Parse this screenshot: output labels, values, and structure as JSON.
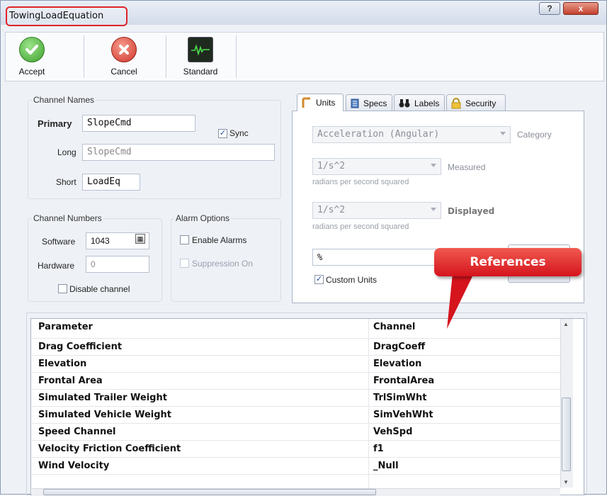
{
  "window": {
    "title": "TowingLoadEquation",
    "help_label": "?",
    "close_label": "x"
  },
  "toolbar": {
    "accept_label": "Accept",
    "cancel_label": "Cancel",
    "standard_label": "Standard"
  },
  "channel_names": {
    "group_label": "Channel Names",
    "primary_label": "Primary",
    "primary_value": "SlopeCmd",
    "sync_label": "Sync",
    "sync_checked": true,
    "long_label": "Long",
    "long_value": "SlopeCmd",
    "short_label": "Short",
    "short_value": "LoadEq"
  },
  "channel_numbers": {
    "group_label": "Channel Numbers",
    "software_label": "Software",
    "software_value": "1043",
    "hardware_label": "Hardware",
    "hardware_value": "0",
    "disable_label": "Disable channel"
  },
  "alarm_options": {
    "group_label": "Alarm Options",
    "enable_label": "Enable Alarms",
    "suppression_label": "Suppression On"
  },
  "tabs": [
    {
      "label": "Units",
      "icon": "units-icon"
    },
    {
      "label": "Specs",
      "icon": "specs-icon"
    },
    {
      "label": "Labels",
      "icon": "binoculars-icon"
    },
    {
      "label": "Security",
      "icon": "lock-icon"
    }
  ],
  "units": {
    "category_value": "Acceleration (Angular)",
    "category_label": "Category",
    "measured_value": "1/s^2",
    "measured_label": "Measured",
    "measured_hint": "radians per second squared",
    "displayed_value": "1/s^2",
    "displayed_label": "Displayed",
    "displayed_hint": "radians per second squared",
    "custom_value": "%",
    "custom_units_label": "Custom Units",
    "custom_units_checked": true
  },
  "callout": {
    "text": "References",
    "color": "#e0242a"
  },
  "table": {
    "headers": [
      "Parameter",
      "Channel"
    ],
    "rows": [
      {
        "parameter": "Drag Coefficient",
        "channel": "DragCoeff"
      },
      {
        "parameter": "Elevation",
        "channel": "Elevation"
      },
      {
        "parameter": "Frontal Area",
        "channel": "FrontalArea"
      },
      {
        "parameter": "Simulated Trailer Weight",
        "channel": "TrlSimWht"
      },
      {
        "parameter": "Simulated Vehicle Weight",
        "channel": "SimVehWht"
      },
      {
        "parameter": "Speed Channel",
        "channel": "VehSpd"
      },
      {
        "parameter": "Velocity Friction Coefficient",
        "channel": "f1"
      },
      {
        "parameter": "Wind Velocity",
        "channel": "_Null"
      }
    ]
  }
}
